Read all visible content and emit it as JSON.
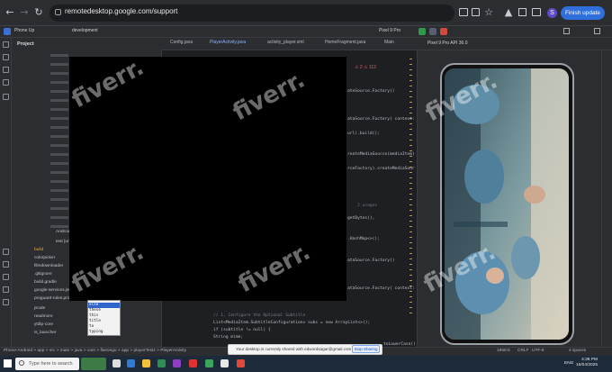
{
  "browser": {
    "url": "remotedesktop.google.com/support",
    "avatar_letter": "S",
    "finish_update_label": "Finish update"
  },
  "ide": {
    "project_name": "Phone Up",
    "branch": "development",
    "device_selector": "Pixel 9 Pro",
    "device_panel_title": "Pixel 9 Pro API 36.0",
    "project_panel_title": "Project",
    "tabs": [
      {
        "label": "Config.java",
        "active": false
      },
      {
        "label": "PlayerActivity.java",
        "active": true
      },
      {
        "label": "activity_player.xml",
        "active": false
      },
      {
        "label": "HomeFragment.java",
        "active": false
      },
      {
        "label": "Main",
        "active": false
      }
    ],
    "tree": [
      "build",
      "colorpicker",
      "filmdownloader",
      "jscale",
      "readmore",
      "ytdlp-core",
      ".gitignore",
      "build.gradle",
      "google-services.json",
      "proguard-rules.pro",
      "AndroidManifest.xml",
      "is_launcher",
      "test [unitTest]"
    ],
    "code_right": [
      "ateSource.Factory()",
      "ataSource.Factory( context: th",
      "url).build();",
      "reateMediaSource(mediaItem)",
      "rceFactory).createMediaSour",
      "getBytes(),",
      ".HashMap<>();",
      "ataSource.Factory()",
      "ataSource.Factory( context: th"
    ],
    "code_bottom": [
      "// 1. Configure the Optional Subtitle",
      "List<MediaItem.SubtitleConfiguration> subs = new ArrayList<>();",
      "if (subtitle != null) {",
      "    String mime;"
    ],
    "code_last": "toLowerCase()",
    "usages_hint": "2 usages",
    "autocomplete": [
      "else",
      "these",
      "this",
      "title",
      "to",
      "typing"
    ],
    "breadcrumb": "Phone-Android > app > src > main > java > com > flamingo > app > playerTestz > PlayerActivity",
    "status": {
      "position": "1858:5",
      "line_ending": "CRLF",
      "encoding": "UTF-8",
      "indent": "4 spaces"
    }
  },
  "share_notice": {
    "text": "Your desktop is currently shared with edwordsagar@gmail.com",
    "stop_label": "Stop Sharing"
  },
  "taskbar": {
    "search_placeholder": "Type here to search",
    "time": "4:38 PM",
    "date": "15/04/2025",
    "lang": "ENG"
  },
  "watermark": "fiverr."
}
